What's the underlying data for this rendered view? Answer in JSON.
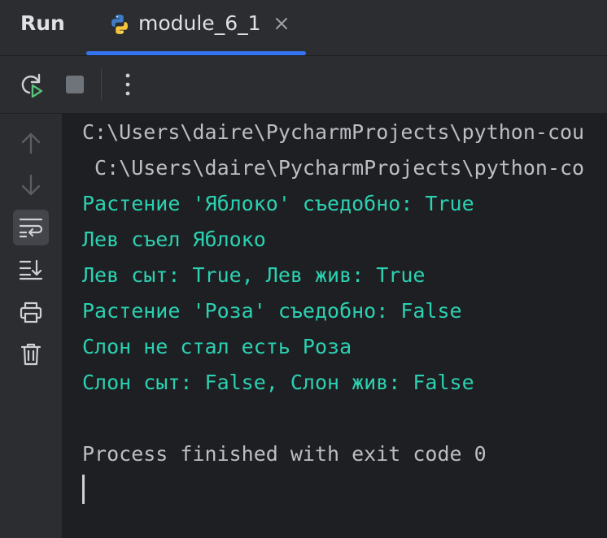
{
  "run_panel": {
    "title": "Run",
    "tab": {
      "name": "module_6_1",
      "icon": "python-icon",
      "close_icon": "close-icon"
    }
  },
  "toolbar": {
    "buttons": [
      "rerun-icon",
      "stop-icon",
      "more-options-icon"
    ]
  },
  "gutter": {
    "buttons": [
      "arrow-up-icon",
      "arrow-down-icon",
      "soft-wrap-icon",
      "scroll-to-end-icon",
      "print-icon",
      "trash-icon"
    ],
    "active": "soft-wrap-icon"
  },
  "console": {
    "lines": [
      "C:\\Users\\daire\\PycharmProjects\\python-cou",
      " C:\\Users\\daire\\PycharmProjects\\python-co",
      "Растение 'Яблоко' съедобно: True",
      "Лев съел Яблоко",
      "Лев сыт: True, Лев жив: True",
      "Растение 'Роза' съедобно: False",
      "Слон не стал есть Роза",
      "Слон сыт: False, Слон жив: False",
      "",
      "Process finished with exit code 0"
    ]
  },
  "colors": {
    "output": "#2bd1b1",
    "default_text": "#bcbec4",
    "accent": "#3574f0"
  }
}
